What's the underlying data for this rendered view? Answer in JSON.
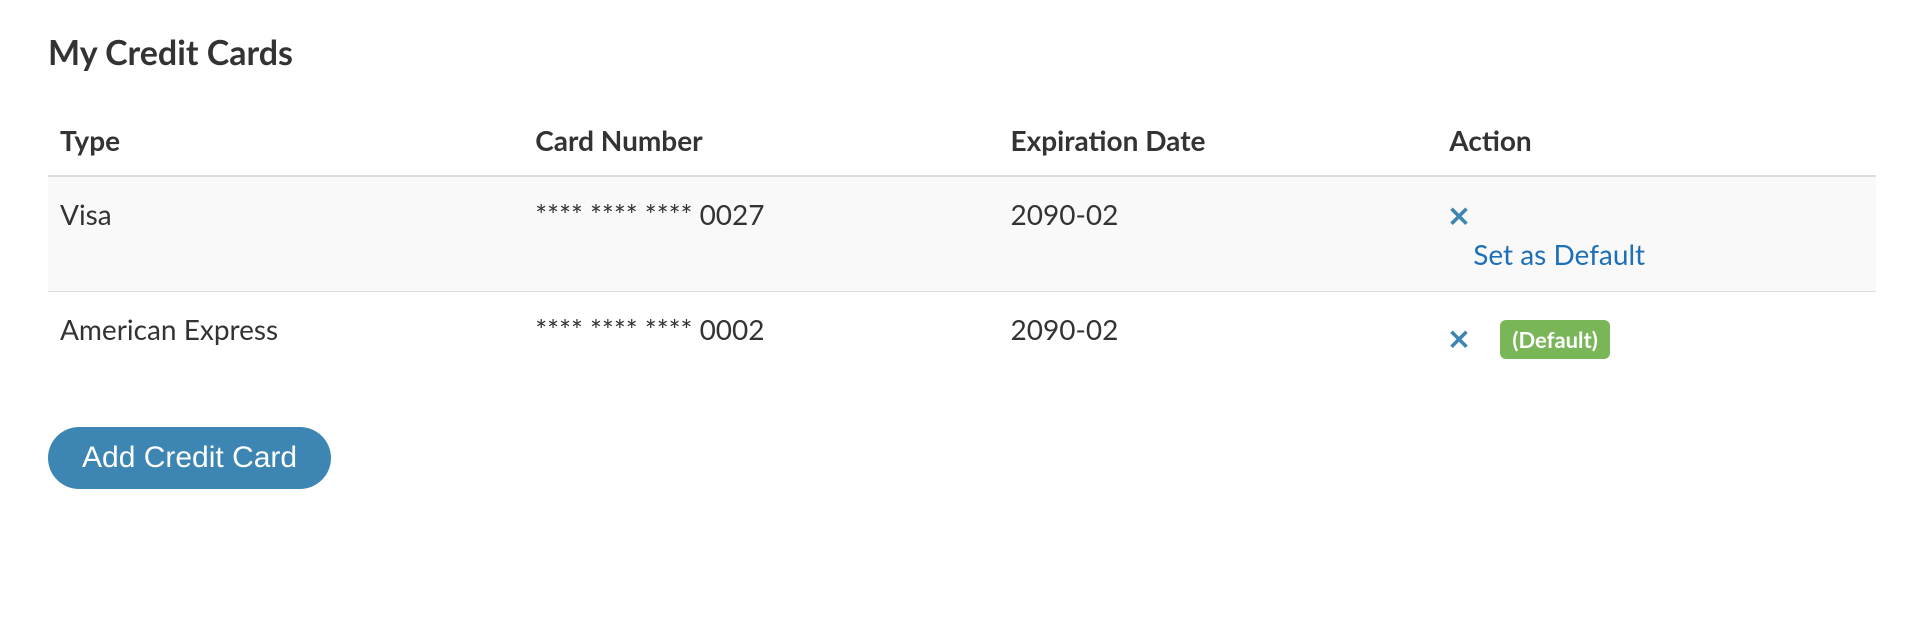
{
  "title": "My Credit Cards",
  "columns": {
    "type": "Type",
    "card_number": "Card Number",
    "expiration": "Expiration Date",
    "action": "Action"
  },
  "rows": [
    {
      "type": "Visa",
      "card_number": "**** **** **** 0027",
      "expiration": "2090-02",
      "set_default_label": "Set as Default",
      "is_default": false
    },
    {
      "type": "American Express",
      "card_number": "**** **** **** 0002",
      "expiration": "2090-02",
      "default_badge": "(Default)",
      "is_default": true
    }
  ],
  "add_button": "Add Credit Card"
}
